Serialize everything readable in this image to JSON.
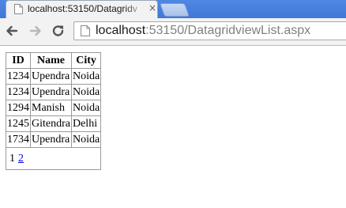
{
  "browser": {
    "tab_title": "localhost:53150/Datagridv",
    "tab_close_glyph": "×",
    "url_host": "localhost",
    "url_rest": ":53150/DatagridviewList.aspx",
    "icons": {
      "tab_page": "page-icon",
      "back": "back-arrow-icon",
      "forward": "forward-arrow-icon",
      "reload": "reload-icon",
      "omnibox_page": "page-icon"
    },
    "colors": {
      "tabstrip": "#4e87e4",
      "toolbar": "#f2f2f2"
    }
  },
  "grid": {
    "headers": [
      "ID",
      "Name",
      "City"
    ],
    "rows": [
      [
        "1234",
        "Upendra",
        "Noida"
      ],
      [
        "1234",
        "Upendra",
        "Noida"
      ],
      [
        "1294",
        "Manish",
        "Noida"
      ],
      [
        "1245",
        "Gitendra",
        "Delhi"
      ],
      [
        "1734",
        "Upendra",
        "Noida"
      ]
    ],
    "pager": {
      "current_page": "1",
      "other_page": "2"
    }
  }
}
